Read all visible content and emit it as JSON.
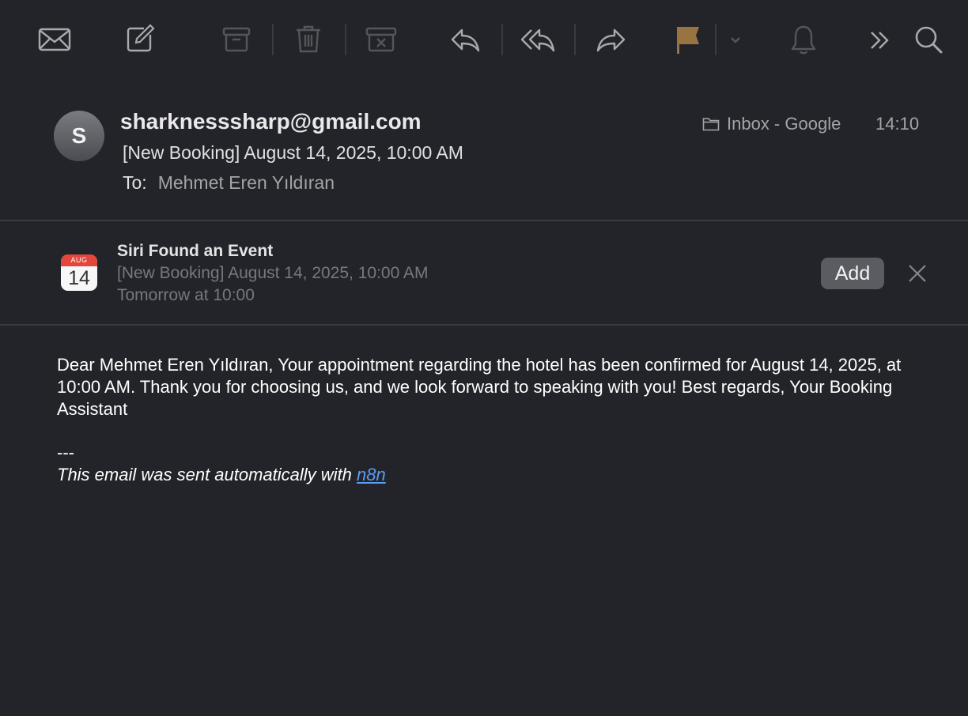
{
  "toolbar": {
    "buttons": [
      {
        "icon": "envelope-icon",
        "label": "Get Mail"
      },
      {
        "icon": "compose-icon",
        "label": "Compose"
      },
      {
        "icon": "archive-icon",
        "label": "Archive"
      },
      {
        "icon": "trash-icon",
        "label": "Delete"
      },
      {
        "icon": "junk-icon",
        "label": "Junk"
      },
      {
        "icon": "reply-icon",
        "label": "Reply"
      },
      {
        "icon": "reply-all-icon",
        "label": "Reply All"
      },
      {
        "icon": "forward-icon",
        "label": "Forward"
      },
      {
        "icon": "flag-icon",
        "label": "Flag"
      },
      {
        "icon": "chevron-down-icon",
        "label": "Flag menu"
      },
      {
        "icon": "bell-icon",
        "label": "Notify"
      },
      {
        "icon": "chevrons-right-icon",
        "label": "More"
      },
      {
        "icon": "search-icon",
        "label": "Search"
      }
    ],
    "flag_color": "#9a7440"
  },
  "message": {
    "avatar_initial": "S",
    "sender": "sharknesssharp@gmail.com",
    "subject": "[New Booking] August 14, 2025, 10:00 AM",
    "to_label": "To:",
    "to_name": "Mehmet Eren Yıldıran",
    "mailbox": "Inbox - Google",
    "time": "14:10"
  },
  "siri": {
    "title": "Siri Found an Event",
    "event": "[New Booking] August 14, 2025, 10:00 AM",
    "when": "Tomorrow at 10:00",
    "cal_month": "AUG",
    "cal_day": "14",
    "add_label": "Add"
  },
  "body": {
    "text": "Dear Mehmet Eren Yıldıran, Your appointment regarding the hotel has been confirmed for August 14, 2025, at 10:00 AM. Thank you for choosing us, and we look forward to speaking with you! Best regards, Your Booking Assistant",
    "separator": "---",
    "footer_prefix": "This email was sent automatically with ",
    "footer_link": "n8n"
  },
  "colors": {
    "background": "#232429",
    "link": "#5b9cf5",
    "calendar_red": "#e5463b"
  }
}
